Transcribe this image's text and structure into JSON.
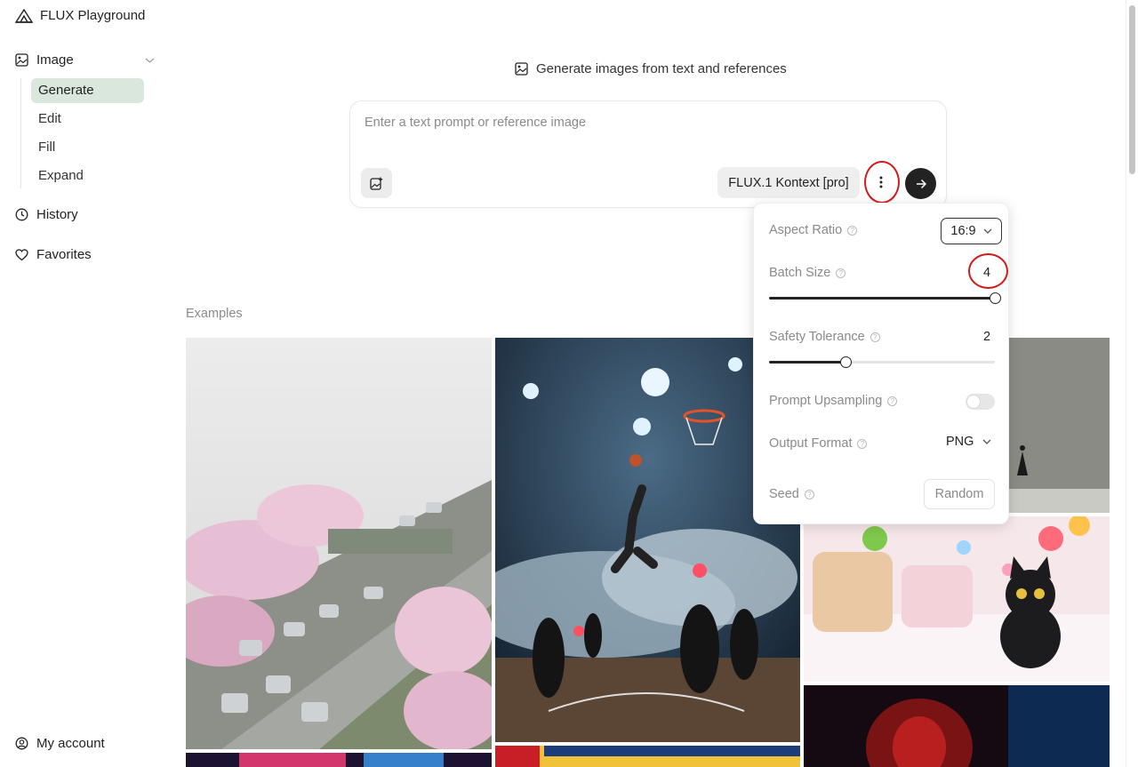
{
  "app": {
    "title": "FLUX Playground"
  },
  "sidebar": {
    "sections": [
      {
        "label": "Image",
        "icon": "image-icon"
      },
      {
        "label": "History",
        "icon": "clock-icon"
      },
      {
        "label": "Favorites",
        "icon": "heart-icon"
      }
    ],
    "subitems": [
      {
        "label": "Generate",
        "active": true
      },
      {
        "label": "Edit",
        "active": false
      },
      {
        "label": "Fill",
        "active": false
      },
      {
        "label": "Expand",
        "active": false
      }
    ],
    "account_label": "My account"
  },
  "header": {
    "title": "Generate images from text and references",
    "icon": "image-icon"
  },
  "prompt": {
    "placeholder": "Enter a text prompt or reference image",
    "value": "",
    "model_label": "FLUX.1 Kontext [pro]"
  },
  "settings": {
    "aspect_ratio": {
      "label": "Aspect Ratio",
      "value": "16:9"
    },
    "batch_size": {
      "label": "Batch Size",
      "value": "4",
      "level": 1.0
    },
    "safety_tolerance": {
      "label": "Safety Tolerance",
      "value": "2",
      "level": 0.34
    },
    "prompt_upsampling": {
      "label": "Prompt Upsampling",
      "enabled": false
    },
    "output_format": {
      "label": "Output Format",
      "value": "PNG"
    },
    "seed": {
      "label": "Seed",
      "button_label": "Random"
    }
  },
  "examples": {
    "label": "Examples",
    "tiles": [
      {
        "subject": "cherry-blossom-highway"
      },
      {
        "subject": "basketball-dunk-smoke"
      },
      {
        "subject": "concrete-room-figure"
      },
      {
        "subject": "black-cat-candy-village"
      },
      {
        "subject": "red-cinema-face"
      },
      {
        "subject": "neon-sign"
      },
      {
        "subject": "comic-covers"
      }
    ]
  },
  "colors": {
    "accent_active": "#d9e7dc",
    "annotation": "#d11a1a",
    "send_button": "#222222"
  }
}
